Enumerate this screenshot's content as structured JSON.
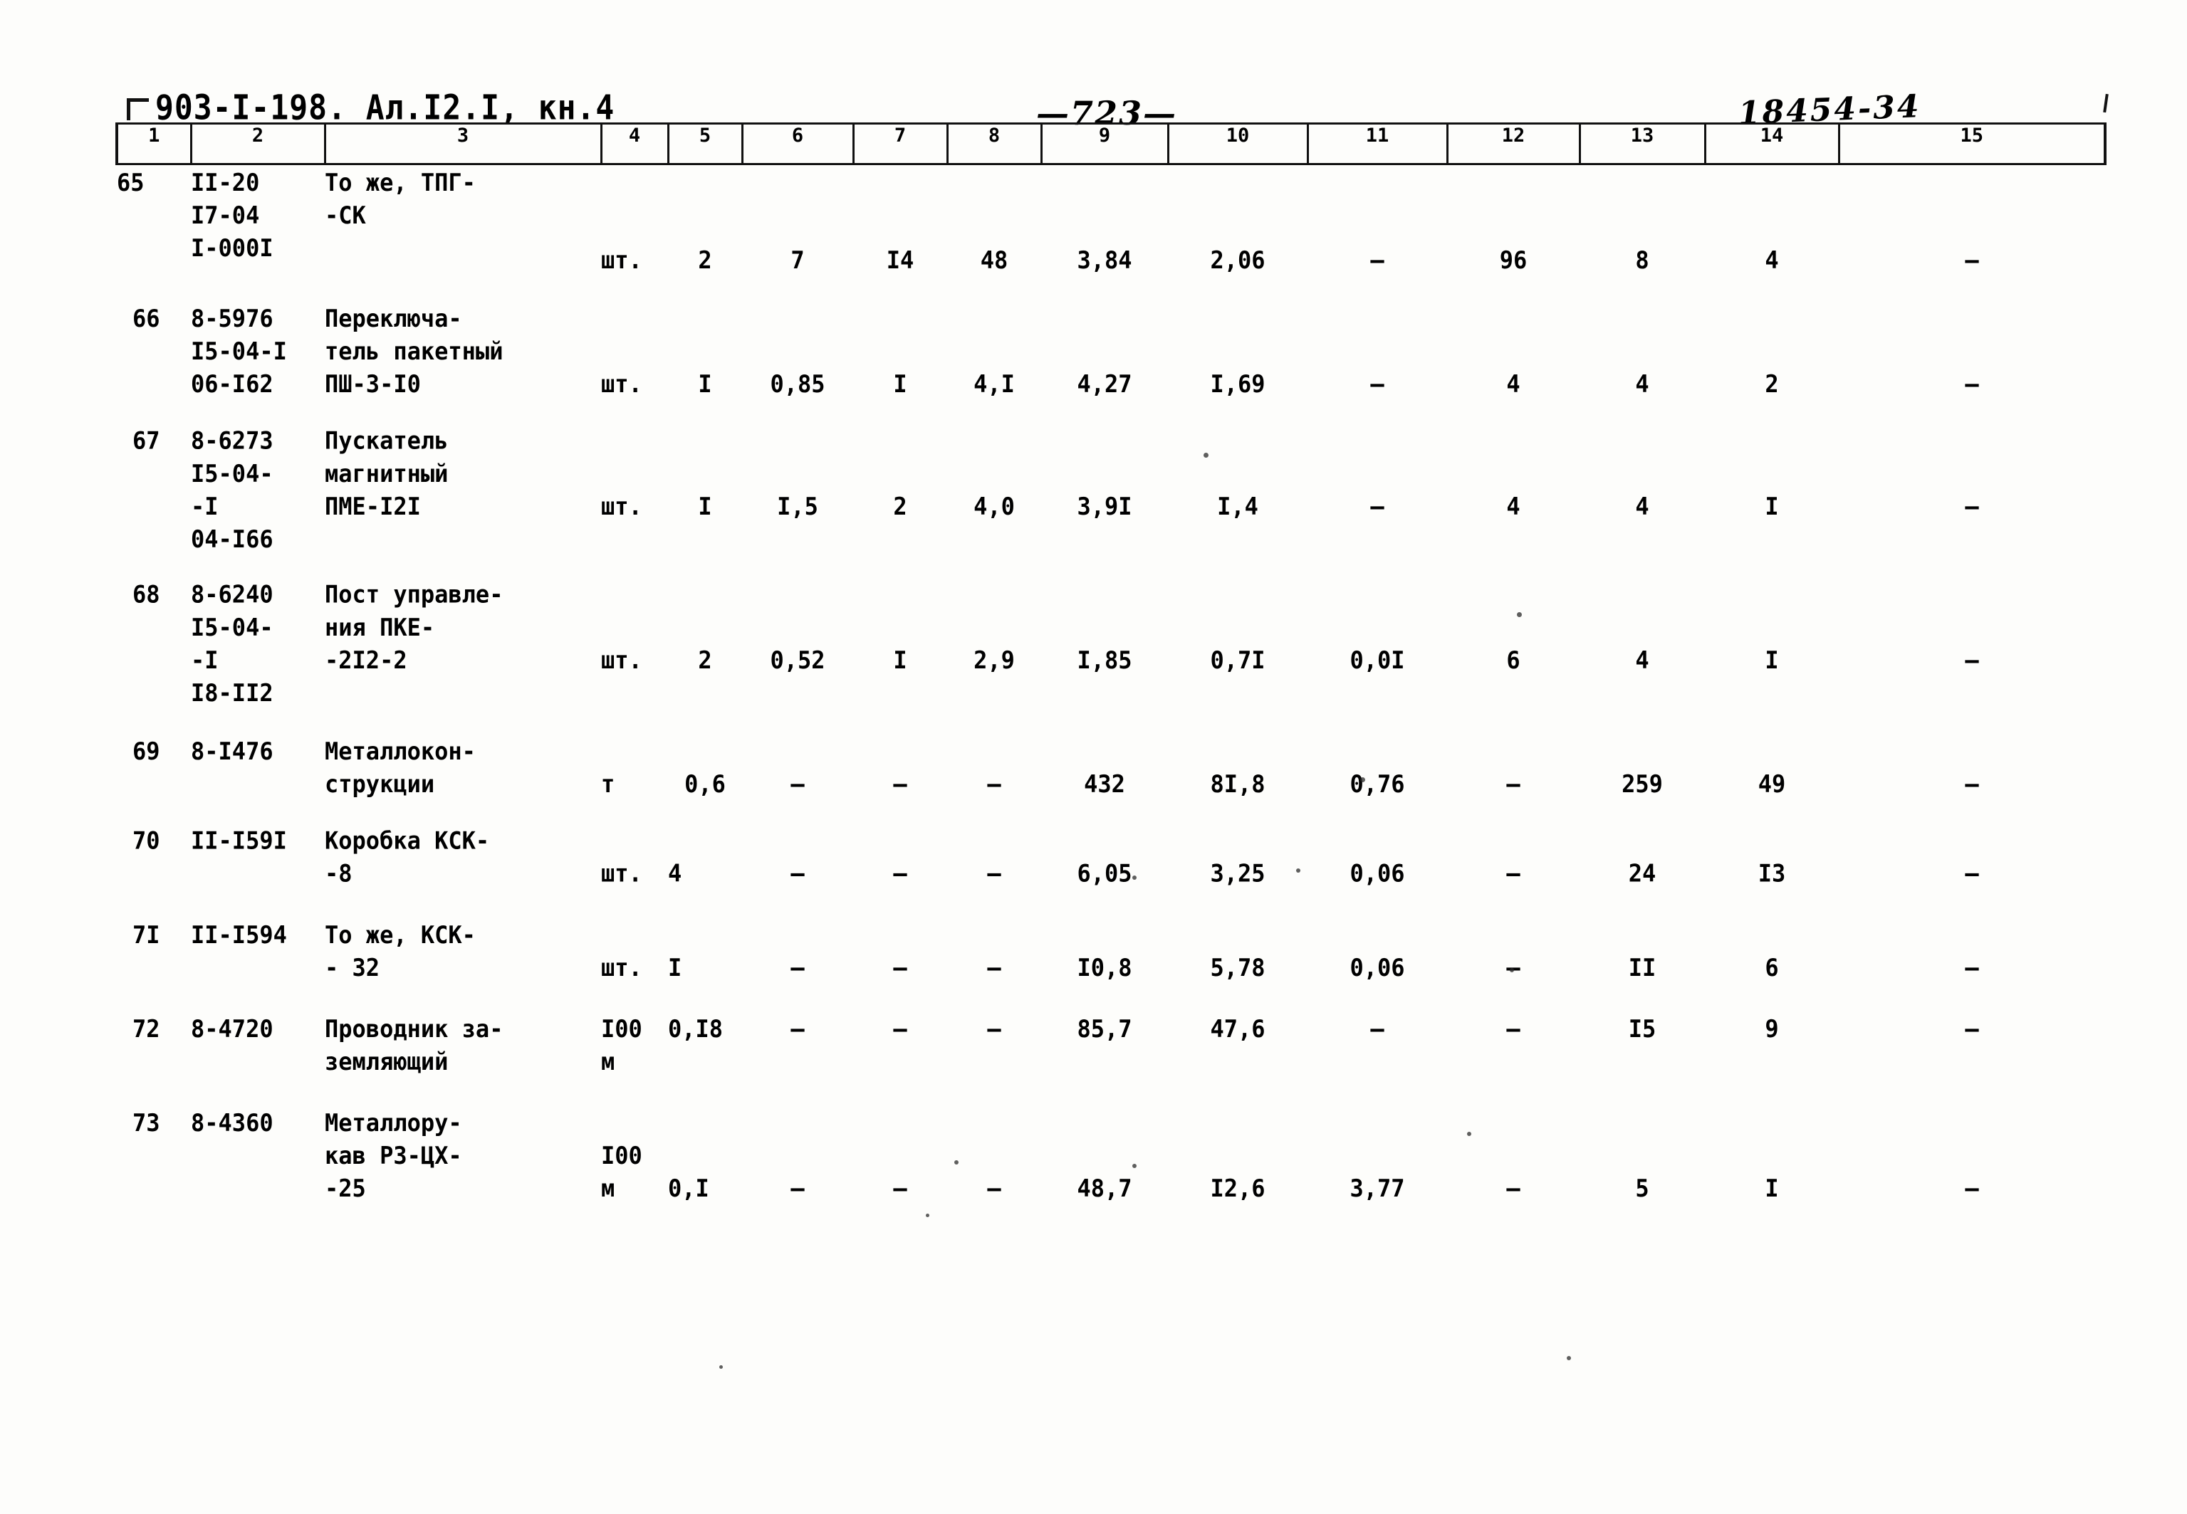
{
  "header": {
    "doc_code": "903-I-198. Ал.I2.I, кн.4",
    "page_number": "—723—",
    "stamp_number": "18454-34"
  },
  "table": {
    "column_headers": [
      "1",
      "2",
      "3",
      "4",
      "5",
      "6",
      "7",
      "8",
      "9",
      "10",
      "11",
      "12",
      "13",
      "14",
      "15"
    ],
    "rows": [
      {
        "num": "65",
        "code": "II-20\nI7-04\nI-000I",
        "name": "То же, ТПГ-\n-СК",
        "unit": "шт.",
        "c5": "2",
        "c6": "7",
        "c7": "I4",
        "c8": "48",
        "c9": "3,84",
        "c10": "2,06",
        "c11": "–",
        "c12": "96",
        "c13": "8",
        "c14": "4",
        "c15": "–"
      },
      {
        "num": "66",
        "code": "8-5976\nI5-04-I\n06-I62",
        "name": "Переключа-\nтель пакетный\nПШ-3-I0",
        "unit": "шт.",
        "c5": "I",
        "c6": "0,85",
        "c7": "I",
        "c8": "4,I",
        "c9": "4,27",
        "c10": "I,69",
        "c11": "–",
        "c12": "4",
        "c13": "4",
        "c14": "2",
        "c15": "–"
      },
      {
        "num": "67",
        "code": "8-6273\nI5-04-\n-I\n04-I66",
        "name": "Пускатель\nмагнитный\nПМЕ-I2I",
        "unit": "шт.",
        "c5": "I",
        "c6": "I,5",
        "c7": "2",
        "c8": "4,0",
        "c9": "3,9I",
        "c10": "I,4",
        "c11": "–",
        "c12": "4",
        "c13": "4",
        "c14": "I",
        "c15": "–"
      },
      {
        "num": "68",
        "code": "8-6240\nI5-04-\n-I\nI8-II2",
        "name": "Пост управле-\nния ПКЕ-\n-2I2-2",
        "unit": "шт.",
        "c5": "2",
        "c6": "0,52",
        "c7": "I",
        "c8": "2,9",
        "c9": "I,85",
        "c10": "0,7I",
        "c11": "0,0I",
        "c12": "6",
        "c13": "4",
        "c14": "I",
        "c15": "–"
      },
      {
        "num": "69",
        "code": "8-I476",
        "name": "Металлокон-\nструкции",
        "unit": "т",
        "c5": "0,6",
        "c6": "–",
        "c7": "–",
        "c8": "–",
        "c9": "432",
        "c10": "8I,8",
        "c11": "0,76",
        "c12": "–",
        "c13": "259",
        "c14": "49",
        "c15": "–"
      },
      {
        "num": "70",
        "code": "II-I59I",
        "name": "Коробка КСК-\n-8",
        "unit": "шт.",
        "c5": "4",
        "c6": "–",
        "c7": "–",
        "c8": "–",
        "c9": "6,05",
        "c10": "3,25",
        "c11": "0,06",
        "c12": "–",
        "c13": "24",
        "c14": "I3",
        "c15": "–"
      },
      {
        "num": "7I",
        "code": "II-I594",
        "name": "  То же, КСК-\n- 32",
        "unit": "шт.",
        "c5": "I",
        "c6": "–",
        "c7": "–",
        "c8": "–",
        "c9": "I0,8",
        "c10": "5,78",
        "c11": "0,06",
        "c12": "–",
        "c13": "II",
        "c14": "6",
        "c15": "–"
      },
      {
        "num": "72",
        "code": "8-4720",
        "name": "Проводник за-\nземляющий",
        "unit": "I00\nм",
        "c5": "0,I8",
        "c6": "–",
        "c7": "–",
        "c8": "–",
        "c9": "85,7",
        "c10": "47,6",
        "c11": "–",
        "c12": "–",
        "c13": "I5",
        "c14": "9",
        "c15": "–"
      },
      {
        "num": "73",
        "code": "8-4360",
        "name": "Металлору-\nкав РЗ-ЦХ-\n-25",
        "unit": "I00\nм",
        "c5": "0,I",
        "c6": "–",
        "c7": "–",
        "c8": "–",
        "c9": "48,7",
        "c10": "I2,6",
        "c11": "3,77",
        "c12": "–",
        "c13": "5",
        "c14": "I",
        "c15": "–"
      }
    ]
  }
}
